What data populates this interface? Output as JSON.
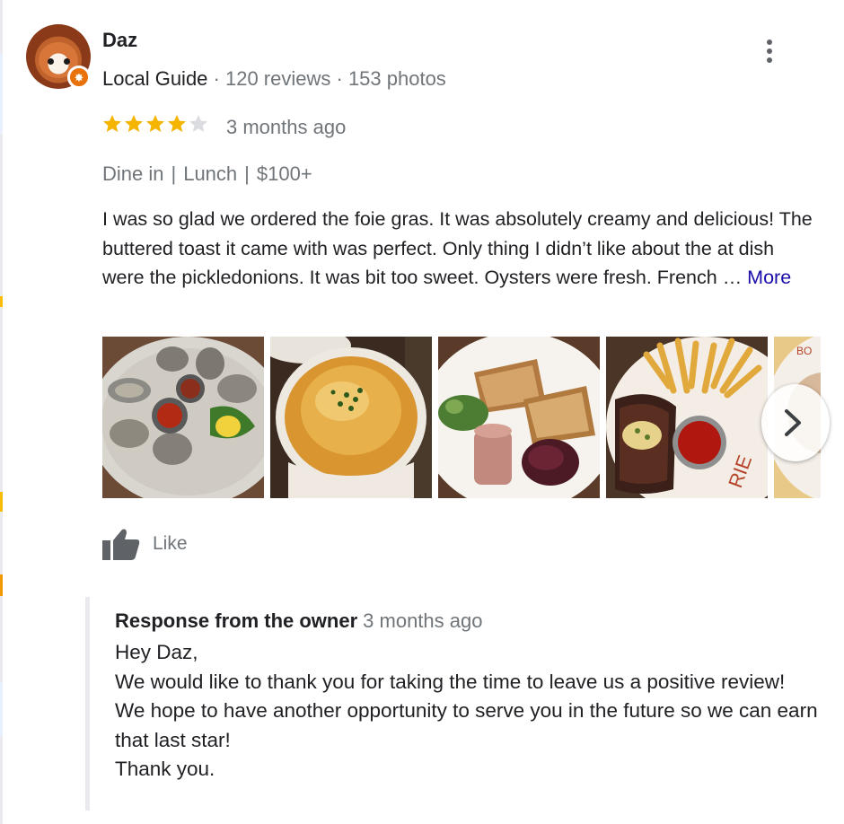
{
  "reviewer": {
    "name": "Daz",
    "guide_label": "Local Guide",
    "reviews": "120 reviews",
    "photos": "153 photos",
    "separator": " · "
  },
  "rating": {
    "value": 4,
    "max": 5,
    "filled_color": "#f4b400",
    "empty_color": "#dadce0"
  },
  "date": "3 months ago",
  "tags": [
    "Dine in",
    "Lunch",
    "$100+"
  ],
  "tag_separator": "|",
  "review_text": "I was so glad we ordered the foie gras. It was absolutely creamy and delicious! The buttered toast it came with was perfect. Only thing I didn’t like about the at dish were the pickledonions. It was bit too sweet. Oysters were fresh. French … ",
  "more_label": "More",
  "photos": [
    {
      "icon": "oysters-photo"
    },
    {
      "icon": "onion-soup-photo"
    },
    {
      "icon": "foie-gras-toast-photo"
    },
    {
      "icon": "steak-frites-photo"
    },
    {
      "icon": "plate-partial-photo"
    }
  ],
  "like_label": "Like",
  "owner_response": {
    "title": "Response from the owner",
    "date": "3 months ago",
    "lines": [
      "Hey Daz,",
      "We would like to thank you for taking the time to leave us a positive review!",
      "We hope to have another opportunity to serve you in the future so we can earn that last star!",
      "Thank you."
    ]
  },
  "colors": {
    "link": "#1a0dab",
    "secondary_text": "#70757a",
    "badge": "#e8710a"
  }
}
